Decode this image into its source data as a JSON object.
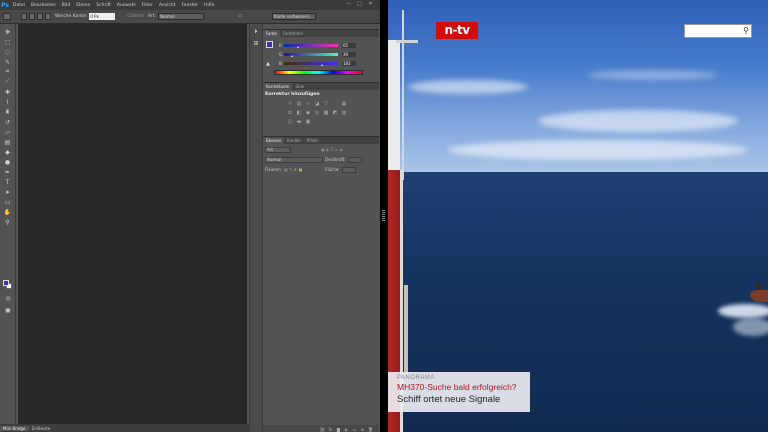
{
  "photoshop": {
    "app_icon": "Ps",
    "menu": [
      "Datei",
      "Bearbeiten",
      "Bild",
      "Ebene",
      "Schrift",
      "Auswahl",
      "Filter",
      "Ansicht",
      "Fenster",
      "Hilfe"
    ],
    "window_controls": [
      "—",
      "□",
      "✕"
    ],
    "options": {
      "feather_label": "Weiche Kante:",
      "feather_value": "0 Px",
      "smooth_label": "Glätten",
      "style_label": "Art:",
      "style_value": "Normal",
      "refine_button": "Kante verbessern..."
    },
    "tools": [
      "move-tool",
      "marquee-tool",
      "lasso-tool",
      "quick-select-tool",
      "crop-tool",
      "eyedropper-tool",
      "healing-tool",
      "brush-tool",
      "stamp-tool",
      "history-brush-tool",
      "eraser-tool",
      "gradient-tool",
      "blur-tool",
      "dodge-tool",
      "pen-tool",
      "type-tool",
      "path-select-tool",
      "shape-tool",
      "hand-tool",
      "zoom-tool"
    ],
    "colors": {
      "foreground": "#3d2fb0",
      "background": "#ffffff"
    },
    "document_tabs": [
      "Mini Bridge",
      "Zeitleiste"
    ],
    "color_panel": {
      "tabs": [
        "Farbe",
        "Farbfelder"
      ],
      "channels": [
        {
          "label": "R",
          "value": "65",
          "knob_pct": 0.26
        },
        {
          "label": "G",
          "value": "39",
          "knob_pct": 0.15
        },
        {
          "label": "B",
          "value": "181",
          "knob_pct": 0.71
        }
      ]
    },
    "adjustments_panel": {
      "tabs": [
        "Korrekturen",
        "Stile"
      ],
      "title": "Korrektur hinzufügen"
    },
    "layers_panel": {
      "tabs": [
        "Ebenen",
        "Kanäle",
        "Pfade"
      ],
      "filter_label": "Art",
      "blend_mode": "Normal",
      "opacity_label": "Deckkraft:",
      "lock_label": "Fixieren:",
      "fill_label": "Fläche:"
    }
  },
  "ntv": {
    "logo": "n-tv",
    "caption": {
      "kicker": "PANORAMA",
      "headline": "MH370-Suche bald erfolgreich?",
      "subline": "Schiff ortet neue Signale"
    },
    "accent_color": "#d10c0c"
  }
}
